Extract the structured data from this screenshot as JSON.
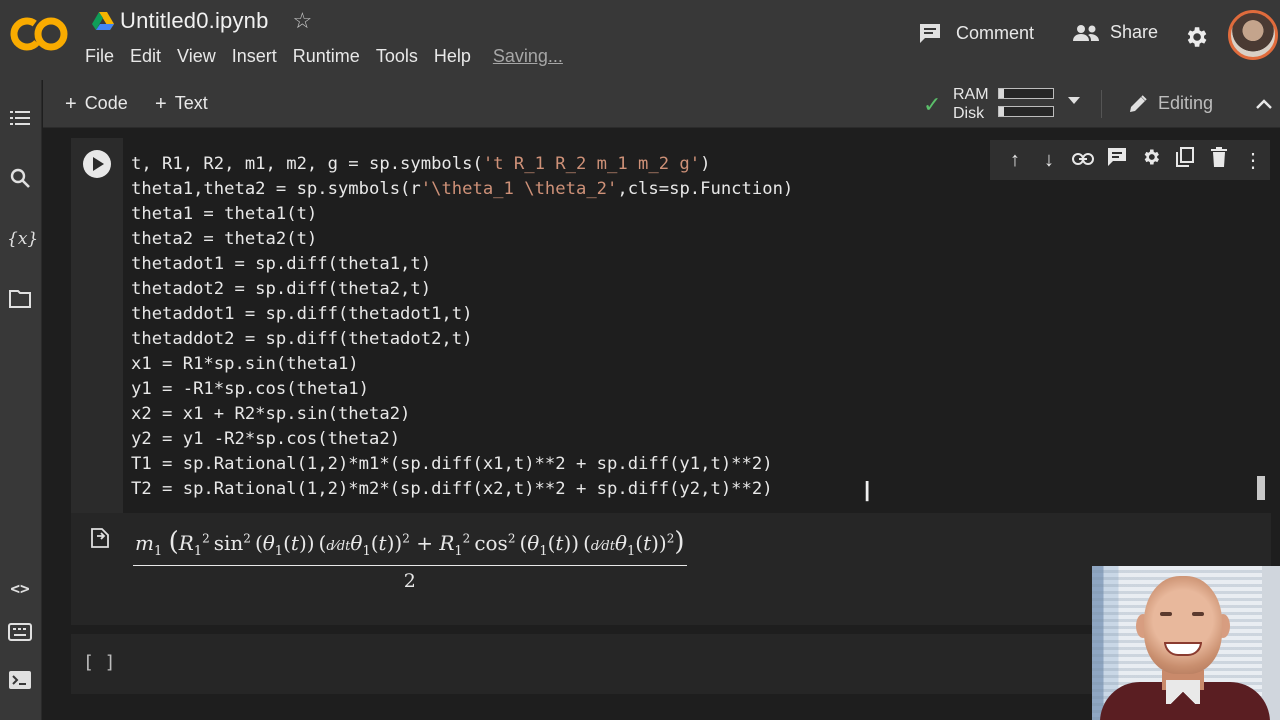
{
  "header": {
    "logo_text": "CO",
    "title": "Untitled0.ipynb",
    "menu": [
      "File",
      "Edit",
      "View",
      "Insert",
      "Runtime",
      "Tools",
      "Help"
    ],
    "saving_label": "Saving...",
    "comment_label": "Comment",
    "share_label": "Share"
  },
  "toolbar": {
    "add_code": "Code",
    "add_text": "Text",
    "ram_label": "RAM",
    "disk_label": "Disk",
    "ram_usage": 0.1,
    "disk_usage": 0.1,
    "editing_label": "Editing"
  },
  "cell1": {
    "code": [
      "t, R1, R2, m1, m2, g = sp.symbols('t R_1 R_2 m_1 m_2 g')",
      "theta1,theta2 = sp.symbols(r'\\theta_1 \\theta_2',cls=sp.Function)",
      "theta1 = theta1(t)",
      "theta2 = theta2(t)",
      "thetadot1 = sp.diff(theta1,t)",
      "thetadot2 = sp.diff(theta2,t)",
      "thetaddot1 = sp.diff(thetadot1,t)",
      "thetaddot2 = sp.diff(thetadot2,t)",
      "x1 = R1*sp.sin(theta1)",
      "y1 = -R1*sp.cos(theta1)",
      "x2 = x1 + R2*sp.sin(theta2)",
      "y2 = y1 -R2*sp.cos(theta2)",
      "T1 = sp.Rational(1,2)*m1*(sp.diff(x1,t)**2 + sp.diff(y1,t)**2)",
      "T2 = sp.Rational(1,2)*m2*(sp.diff(x2,t)**2 + sp.diff(y2,t)**2)"
    ],
    "output_denominator": "2"
  },
  "cell2": {
    "prompt": "[ ]"
  },
  "colors": {
    "header_bg": "#383838",
    "editor_bg": "#1e1e1e",
    "string_color": "#ce9178",
    "check_green": "#5bbf6a",
    "logo_orange": "#f9ab00"
  }
}
